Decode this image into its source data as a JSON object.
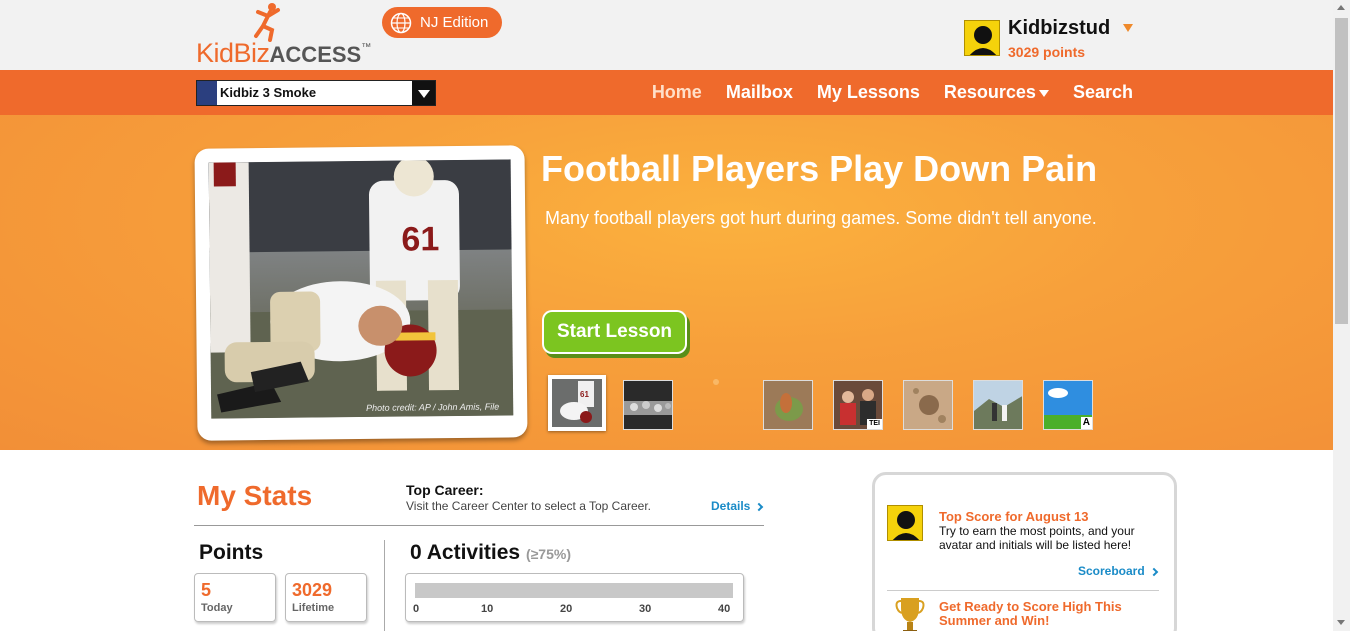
{
  "header": {
    "logo_kid": "KidBiz",
    "logo_access": "ACCESS",
    "logo_tm": "™",
    "edition_label": "NJ Edition",
    "username": "Kidbizstud",
    "points": "3029 points"
  },
  "nav": {
    "class_select_value": "Kidbiz 3 Smoke",
    "links": [
      {
        "label": "Home",
        "active": true
      },
      {
        "label": "Mailbox"
      },
      {
        "label": "My Lessons"
      },
      {
        "label": "Resources"
      },
      {
        "label": "Search"
      }
    ]
  },
  "hero": {
    "title": "Football Players Play Down Pain",
    "description": "Many football players got hurt during games. Some didn't tell anyone.",
    "start_label": "Start Lesson",
    "photo_credit": "Photo credit: AP / John Amis, File",
    "thumbnails": [
      {
        "name": "football",
        "badge": ""
      },
      {
        "name": "crowd",
        "badge": ""
      },
      {
        "name": "plant",
        "badge": ""
      },
      {
        "name": "people",
        "badge": "TEI"
      },
      {
        "name": "ground",
        "badge": ""
      },
      {
        "name": "hikers",
        "badge": ""
      },
      {
        "name": "field",
        "badge": "A"
      }
    ]
  },
  "stats": {
    "title": "My Stats",
    "top_career_label": "Top Career:",
    "top_career_desc": "Visit the Career Center to select a Top Career.",
    "details_label": "Details",
    "points_title": "Points",
    "points_today_value": "5",
    "points_today_label": "Today",
    "points_lifetime_value": "3029",
    "points_lifetime_label": "Lifetime",
    "activities_title": "0 Activities",
    "activities_sub": "(≥75%)",
    "activities_progress": 0,
    "activity_ticks": [
      "0",
      "10",
      "20",
      "30",
      "40"
    ]
  },
  "sidebar": {
    "top_score_title": "Top Score for August 13",
    "top_score_desc": "Try to earn the most points, and your avatar and initials will be listed here!",
    "scoreboard_label": "Scoreboard",
    "promo_title": "Get Ready to Score High This Summer and Win!"
  },
  "colors": {
    "brand_orange": "#ef6a2c",
    "hero_orange": "#f7a03b",
    "start_green": "#7cc520",
    "link_blue": "#1a8bc7"
  }
}
